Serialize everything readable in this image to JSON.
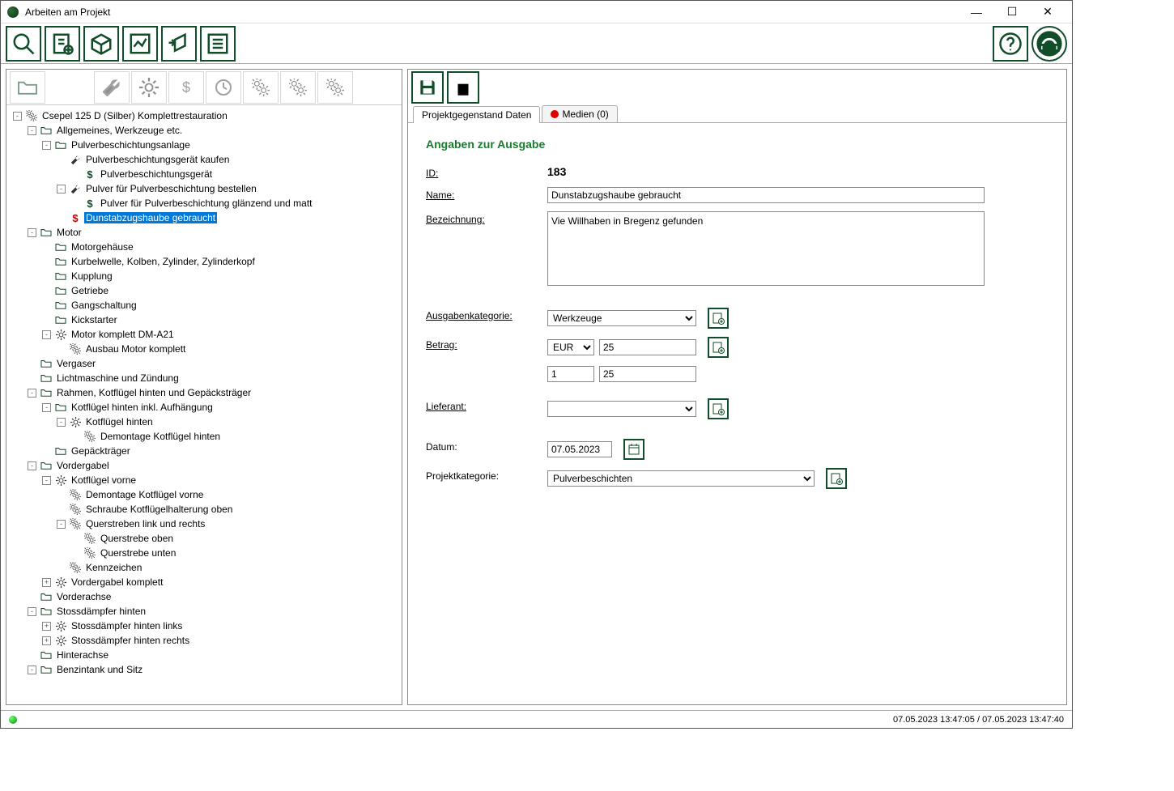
{
  "window": {
    "title": "Arbeiten am Projekt"
  },
  "tabs": {
    "data": "Projektgegenstand Daten",
    "media": "Medien (0)"
  },
  "form": {
    "title": "Angaben zur Ausgabe",
    "id_label": "ID:",
    "id_value": "183",
    "name_label": "Name:",
    "name_value": "Dunstabzugshaube gebraucht",
    "desc_label": "Bezeichnung:",
    "desc_value": "Vie Willhaben in Bregenz gefunden",
    "category_label": "Ausgabenkategorie:",
    "category_value": "Werkzeuge",
    "amount_label": "Betrag:",
    "currency": "EUR",
    "amount1": "25",
    "qty": "1",
    "amount2": "25",
    "supplier_label": "Lieferant:",
    "supplier_value": "",
    "date_label": "Datum:",
    "date_value": "07.05.2023",
    "proj_cat_label": "Projektkategorie:",
    "proj_cat_value": "Pulverbeschichten"
  },
  "statusbar": {
    "text": "07.05.2023 13:47:05 / 07.05.2023 13:47:40"
  },
  "tree": [
    {
      "depth": 0,
      "toggle": "-",
      "icon": "gear2",
      "label": "Csepel 125 D (Silber) Komplettrestauration"
    },
    {
      "depth": 1,
      "toggle": "-",
      "icon": "folder",
      "label": "Allgemeines, Werkzeuge etc."
    },
    {
      "depth": 2,
      "toggle": "-",
      "icon": "folder",
      "label": "Pulverbeschichtungsanlage"
    },
    {
      "depth": 3,
      "toggle": "",
      "icon": "wrench",
      "label": "Pulverbeschichtungsgerät kaufen"
    },
    {
      "depth": 4,
      "toggle": "",
      "icon": "dollar",
      "label": "Pulverbeschichtungsgerät"
    },
    {
      "depth": 3,
      "toggle": "-",
      "icon": "wrench",
      "label": "Pulver für Pulverbeschichtung bestellen"
    },
    {
      "depth": 4,
      "toggle": "",
      "icon": "dollar",
      "label": "Pulver für Pulverbeschichtung glänzend und matt"
    },
    {
      "depth": 3,
      "toggle": "",
      "icon": "dollar-red",
      "label": "Dunstabzugshaube gebraucht",
      "selected": true
    },
    {
      "depth": 1,
      "toggle": "-",
      "icon": "folder",
      "label": "Motor"
    },
    {
      "depth": 2,
      "toggle": "",
      "icon": "folder",
      "label": "Motorgehäuse"
    },
    {
      "depth": 2,
      "toggle": "",
      "icon": "folder",
      "label": "Kurbelwelle, Kolben, Zylinder, Zylinderkopf"
    },
    {
      "depth": 2,
      "toggle": "",
      "icon": "folder",
      "label": "Kupplung"
    },
    {
      "depth": 2,
      "toggle": "",
      "icon": "folder",
      "label": "Getriebe"
    },
    {
      "depth": 2,
      "toggle": "",
      "icon": "folder",
      "label": "Gangschaltung"
    },
    {
      "depth": 2,
      "toggle": "",
      "icon": "folder",
      "label": "Kickstarter"
    },
    {
      "depth": 2,
      "toggle": "-",
      "icon": "gear",
      "label": "Motor komplett DM-A21"
    },
    {
      "depth": 3,
      "toggle": "",
      "icon": "gear2",
      "label": "Ausbau Motor komplett"
    },
    {
      "depth": 1,
      "toggle": "",
      "icon": "folder",
      "label": "Vergaser"
    },
    {
      "depth": 1,
      "toggle": "",
      "icon": "folder",
      "label": "Lichtmaschine und Zündung"
    },
    {
      "depth": 1,
      "toggle": "-",
      "icon": "folder",
      "label": "Rahmen, Kotflügel hinten und Gepäcksträger"
    },
    {
      "depth": 2,
      "toggle": "-",
      "icon": "folder",
      "label": "Kotflügel hinten inkl. Aufhängung"
    },
    {
      "depth": 3,
      "toggle": "-",
      "icon": "gear",
      "label": "Kotflügel hinten"
    },
    {
      "depth": 4,
      "toggle": "",
      "icon": "gear2",
      "label": "Demontage Kotflügel hinten"
    },
    {
      "depth": 2,
      "toggle": "",
      "icon": "folder",
      "label": "Gepäckträger"
    },
    {
      "depth": 1,
      "toggle": "-",
      "icon": "folder",
      "label": "Vordergabel"
    },
    {
      "depth": 2,
      "toggle": "-",
      "icon": "gear",
      "label": "Kotflügel vorne"
    },
    {
      "depth": 3,
      "toggle": "",
      "icon": "gear2",
      "label": "Demontage Kotflügel vorne"
    },
    {
      "depth": 3,
      "toggle": "",
      "icon": "gear2",
      "label": "Schraube Kotflügelhalterung oben"
    },
    {
      "depth": 3,
      "toggle": "-",
      "icon": "gear2",
      "label": "Querstreben link und rechts"
    },
    {
      "depth": 4,
      "toggle": "",
      "icon": "gear2",
      "label": "Querstrebe oben"
    },
    {
      "depth": 4,
      "toggle": "",
      "icon": "gear2",
      "label": "Querstrebe unten"
    },
    {
      "depth": 3,
      "toggle": "",
      "icon": "gear2",
      "label": "Kennzeichen"
    },
    {
      "depth": 2,
      "toggle": "+",
      "icon": "gear",
      "label": "Vordergabel komplett"
    },
    {
      "depth": 1,
      "toggle": "",
      "icon": "folder",
      "label": "Vorderachse"
    },
    {
      "depth": 1,
      "toggle": "-",
      "icon": "folder",
      "label": "Stossdämpfer hinten"
    },
    {
      "depth": 2,
      "toggle": "+",
      "icon": "gear",
      "label": "Stossdämpfer hinten links"
    },
    {
      "depth": 2,
      "toggle": "+",
      "icon": "gear",
      "label": "Stossdämpfer hinten rechts"
    },
    {
      "depth": 1,
      "toggle": "",
      "icon": "folder",
      "label": "Hinterachse"
    },
    {
      "depth": 1,
      "toggle": "-",
      "icon": "folder",
      "label": "Benzintank und Sitz"
    }
  ]
}
